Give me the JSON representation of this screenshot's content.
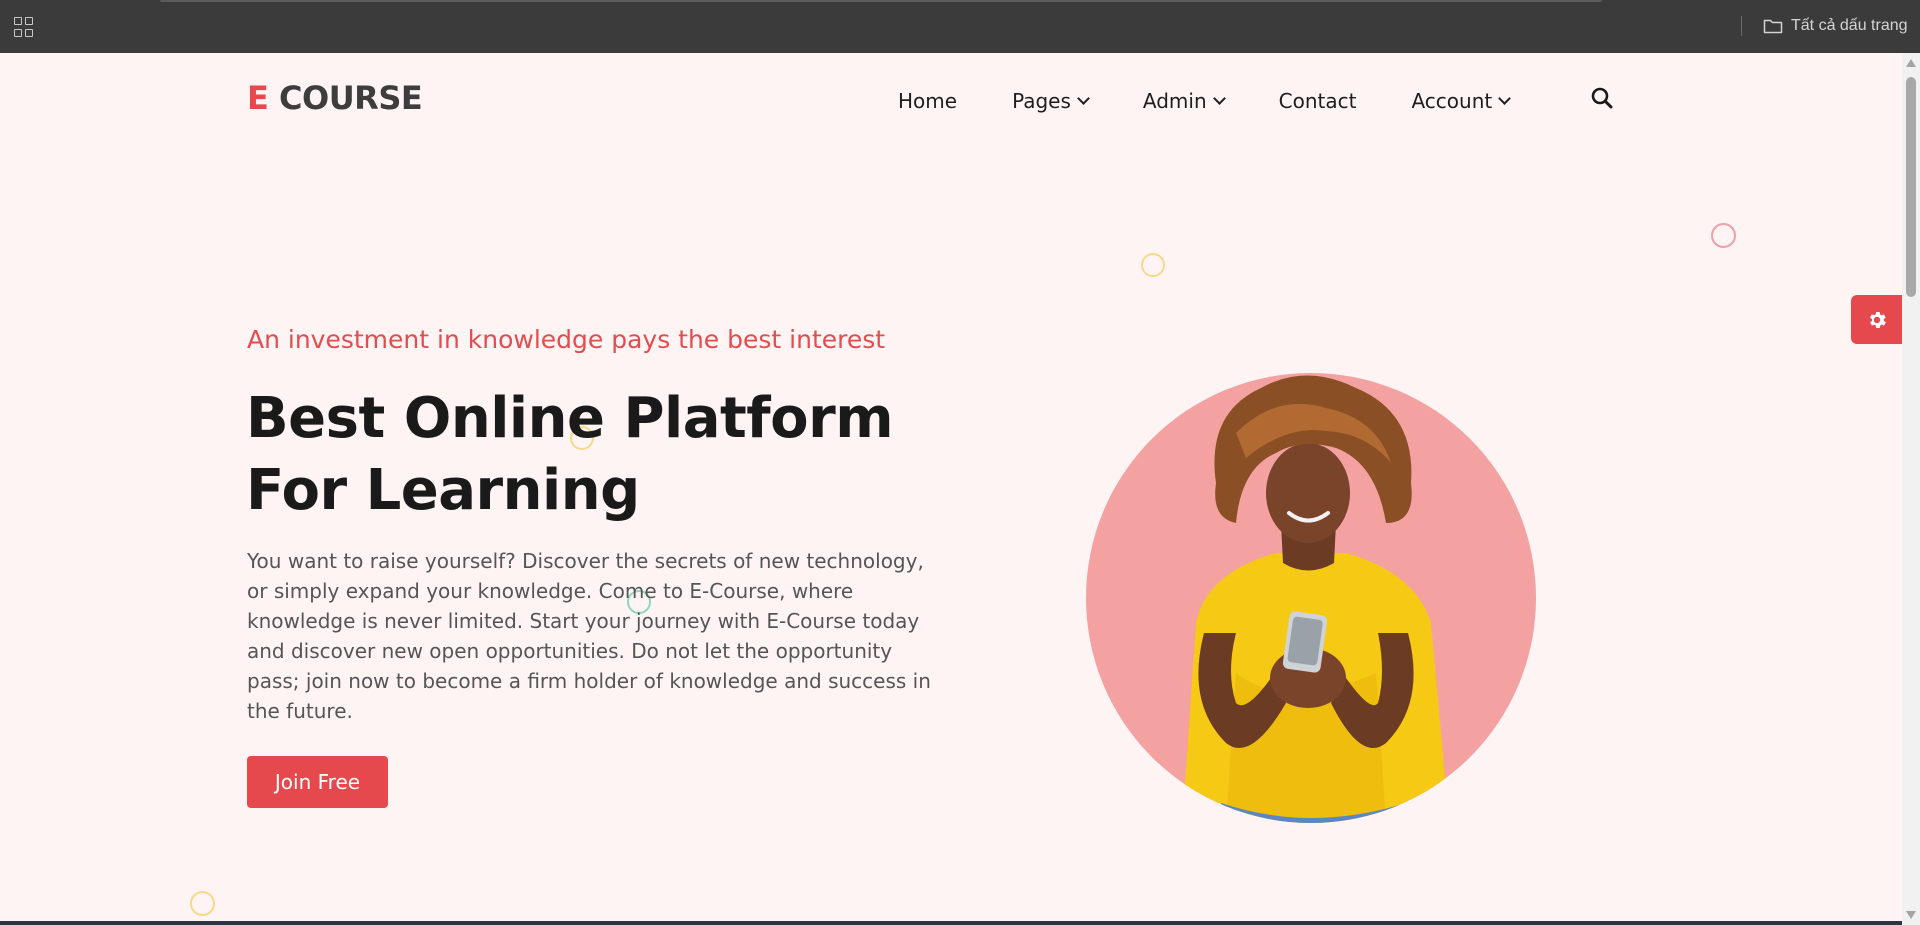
{
  "browser": {
    "bookmarks_label": "Tất cả dấu trang",
    "apps_icon": "apps-grid-icon",
    "folder_icon": "folder-icon"
  },
  "nav": {
    "logo_accent": "E",
    "logo_main": "COURSE",
    "items": [
      {
        "label": "Home",
        "dropdown": false
      },
      {
        "label": "Pages",
        "dropdown": true
      },
      {
        "label": "Admin",
        "dropdown": true
      },
      {
        "label": "Contact",
        "dropdown": false
      },
      {
        "label": "Account",
        "dropdown": true
      }
    ],
    "search_icon": "search-icon"
  },
  "hero": {
    "subtitle": "An investment in knowledge pays the best interest",
    "headline_line1": "Best Online Platform",
    "headline_line2": "For Learning",
    "description": "You want to raise yourself? Discover the secrets of new technology, or simply expand your knowledge. Come to E-Course, where knowledge is never limited. Start your journey with E-Course today and discover new open opportunities. Do not let the opportunity pass; join now to become a firm holder of knowledge and success in the future.",
    "cta_label": "Join Free"
  },
  "settings_icon": "gear-icon",
  "colors": {
    "accent": "#e5494d",
    "page_bg": "#fdf4f3",
    "circle_bg": "#f4a1a1",
    "shirt": "#f6c915"
  }
}
